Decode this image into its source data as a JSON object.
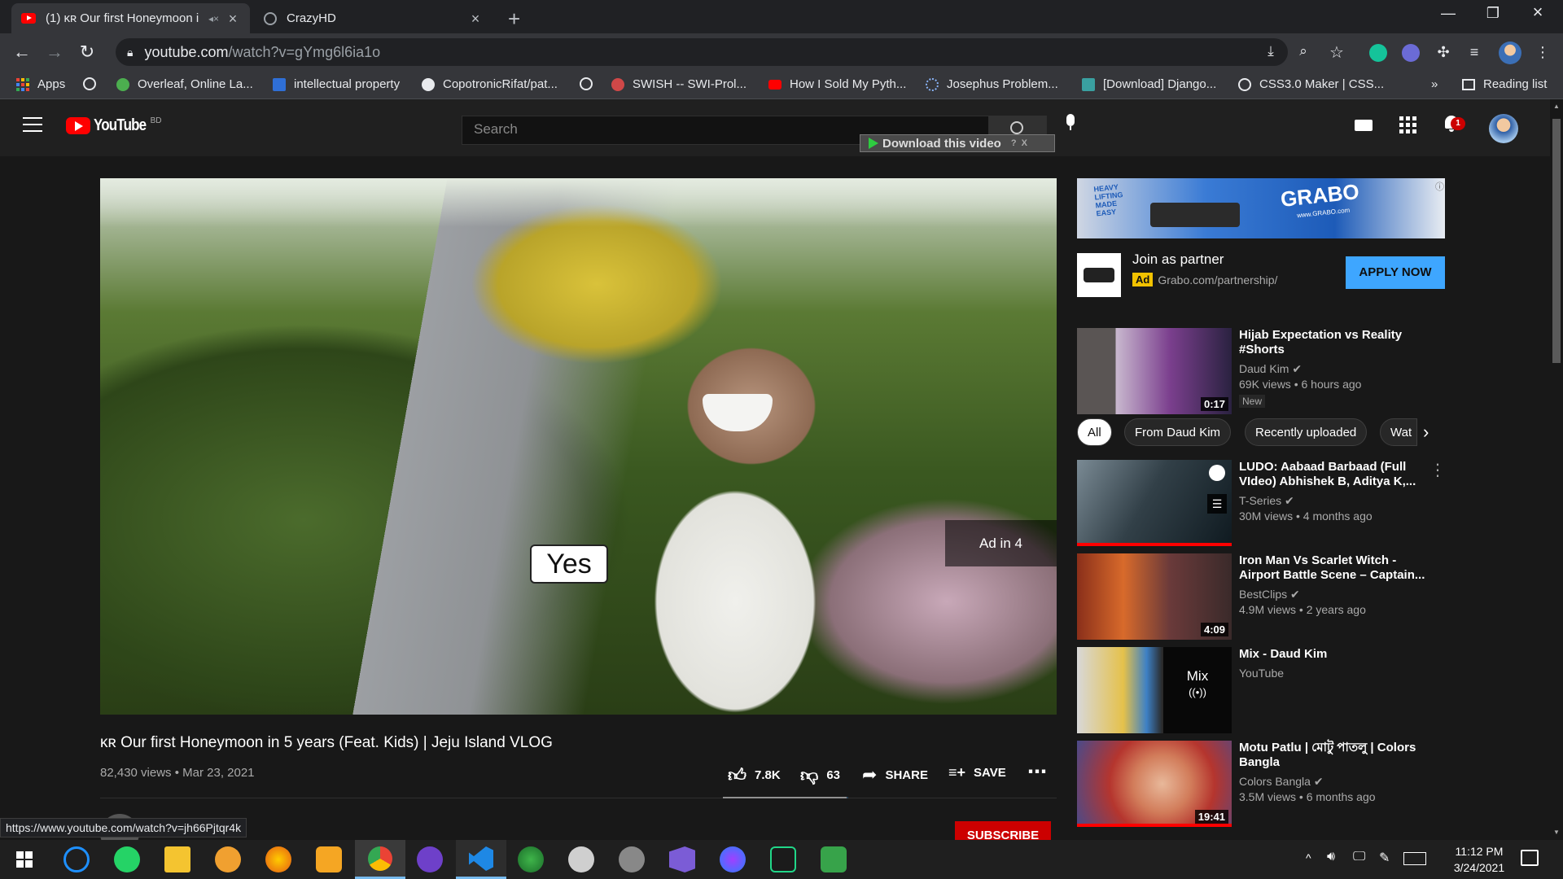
{
  "browser": {
    "tabs": [
      {
        "title": "(1) ᴋʀ Our first Honeymoon i",
        "active": true
      },
      {
        "title": "CrazyHD",
        "active": false
      }
    ],
    "url_host": "youtube.com",
    "url_path": "/watch?v=gYmg6l6ia1o",
    "bookmarks": [
      "Apps",
      "Overleaf, Online La...",
      "intellectual property",
      "CopotronicRifat/pat...",
      "SWISH -- SWI-Prol...",
      "How I Sold My Pyth...",
      "Josephus Problem...",
      "[Download] Django...",
      "CSS3.0 Maker | CSS..."
    ],
    "bookmarks_more": "»",
    "reading_list": "Reading list",
    "status_url": "https://www.youtube.com/watch?v=jh66Pjtqr4k"
  },
  "youtube": {
    "logo": "YouTube",
    "region": "BD",
    "search_placeholder": "Search",
    "download_bar": "Download this video",
    "download_bar_help": "?",
    "download_bar_close": "X",
    "notif_count": "1"
  },
  "video": {
    "overlay_text": "Yes",
    "ad_countdown": "Ad in 4",
    "title": "ᴋʀ Our first Honeymoon in 5 years (Feat. Kids) | Jeju Island VLOG",
    "meta": "82,430 views • Mar 23, 2021",
    "likes": "7.8K",
    "dislikes": "63",
    "share": "SHARE",
    "save": "SAVE",
    "subscribe": "SUBSCRIBE",
    "like_ratio": 0.99
  },
  "sidebar": {
    "ad": {
      "banner_brand": "GRABO",
      "banner_url": "www.GRABO.com",
      "banner_tag": "HEAVY LIFTING MADE EASY",
      "title": "Join as partner",
      "ad_label": "Ad",
      "url": "Grabo.com/partnership/",
      "cta": "APPLY NOW"
    },
    "chips": [
      "All",
      "From Daud Kim",
      "Recently uploaded",
      "Wat"
    ],
    "videos": [
      {
        "title": "Hijab Expectation vs Reality #Shorts",
        "channel": "Daud Kim",
        "stats": "69K views • 6 hours ago",
        "duration": "0:17",
        "badge": "New"
      },
      {
        "title": "LUDO: Aabaad Barbaad (Full VIdeo) Abhishek B, Aditya K,...",
        "channel": "T-Series",
        "stats": "30M views • 4 months ago",
        "duration": ""
      },
      {
        "title": "Iron Man Vs Scarlet Witch - Airport Battle Scene – Captain...",
        "channel": "BestClips",
        "stats": "4.9M views • 2 years ago",
        "duration": "4:09"
      },
      {
        "title": "Mix - Daud Kim",
        "channel": "YouTube",
        "stats": "",
        "duration": "",
        "mix_label": "Mix"
      },
      {
        "title": "Motu Patlu | মোটু পাতলু | Colors Bangla",
        "channel": "Colors Bangla",
        "stats": "3.5M views • 6 months ago",
        "duration": "19:41"
      }
    ]
  },
  "taskbar": {
    "time": "11:12 PM",
    "date": "3/24/2021"
  },
  "colors": {
    "youtube_red": "#ff0000",
    "apply_blue": "#3ea6ff",
    "subscribe_red": "#cc0000",
    "chrome_dark": "#202124"
  }
}
